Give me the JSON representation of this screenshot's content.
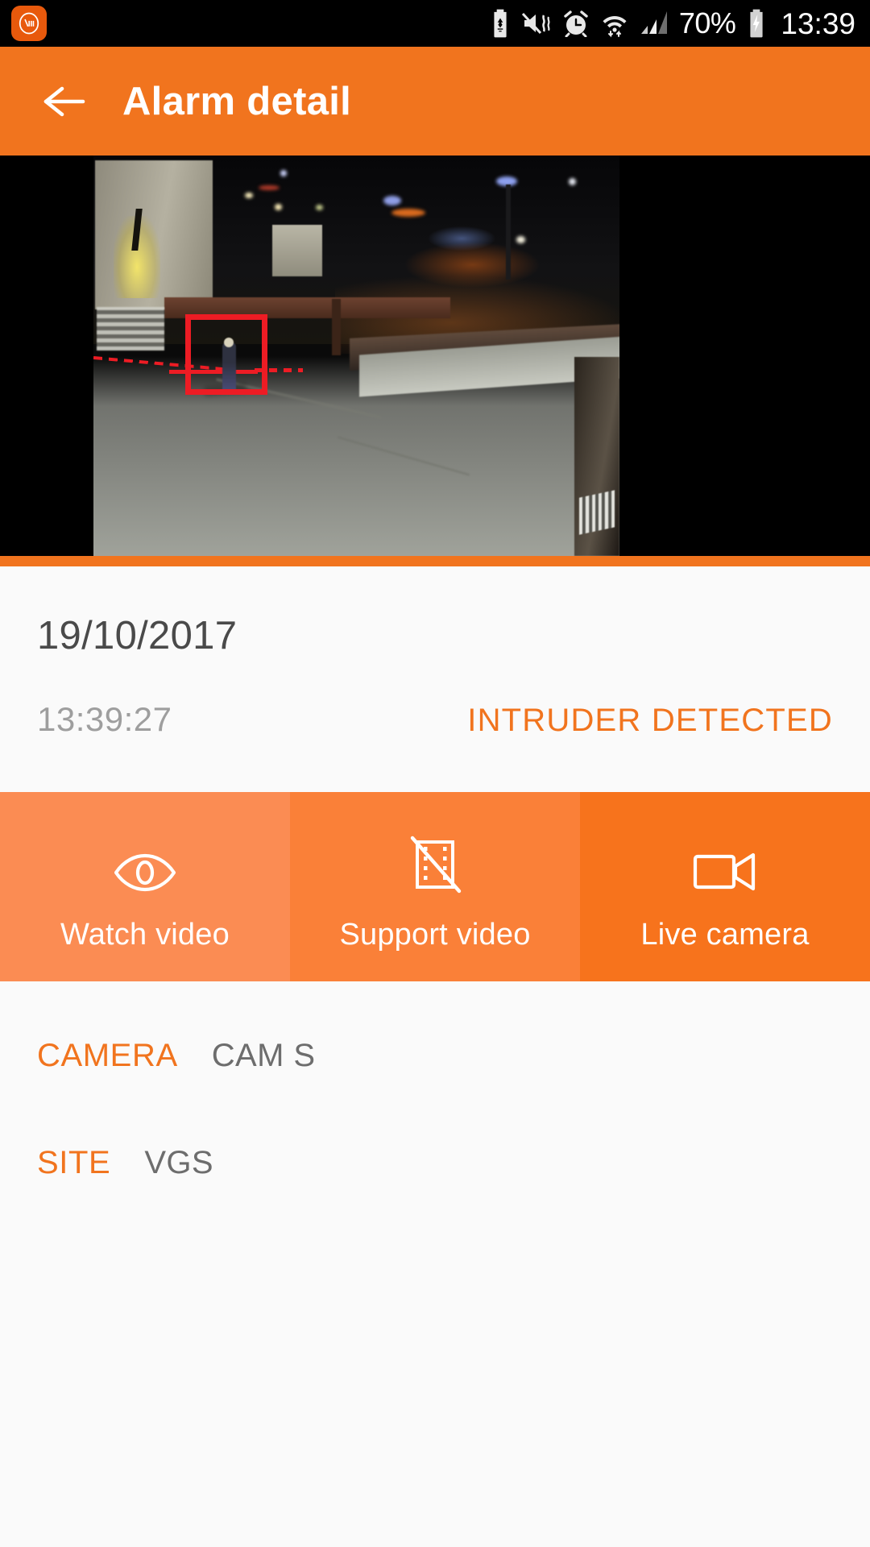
{
  "status_bar": {
    "app_badge": "mi-logo-icon",
    "icons": [
      {
        "name": "battery-saver-icon"
      },
      {
        "name": "volume-mute-vibrate-icon"
      },
      {
        "name": "alarm-clock-icon"
      },
      {
        "name": "wifi-icon"
      },
      {
        "name": "cellular-signal-icon"
      }
    ],
    "battery_percent": "70%",
    "battery_icon": "battery-charging-icon",
    "clock": "13:39"
  },
  "app_bar": {
    "back_icon": "arrow-left-icon",
    "title": "Alarm detail"
  },
  "snapshot": {
    "alt": "night-time cctv snapshot with intruder bounding box",
    "detection_box_color": "#ED1C24",
    "track_color": "#ED1C24"
  },
  "detail": {
    "date": "19/10/2017",
    "time": "13:39:27",
    "alarm_status": "INTRUDER DETECTED",
    "status_color": "#F1741E"
  },
  "actions": [
    {
      "label": "Watch video",
      "icon": "eye-icon",
      "bg": "#FB8C53"
    },
    {
      "label": "Support video",
      "icon": "film-slashed-icon",
      "bg": "#FA8038"
    },
    {
      "label": "Live camera",
      "icon": "video-camera-icon",
      "bg": "#F7731C"
    }
  ],
  "meta": [
    {
      "key": "CAMERA",
      "value": "CAM S"
    },
    {
      "key": "SITE",
      "value": "VGS"
    }
  ],
  "colors": {
    "brand_orange": "#F1741E",
    "page_bg": "#FAFAFA",
    "status_bar_bg": "#000000"
  }
}
